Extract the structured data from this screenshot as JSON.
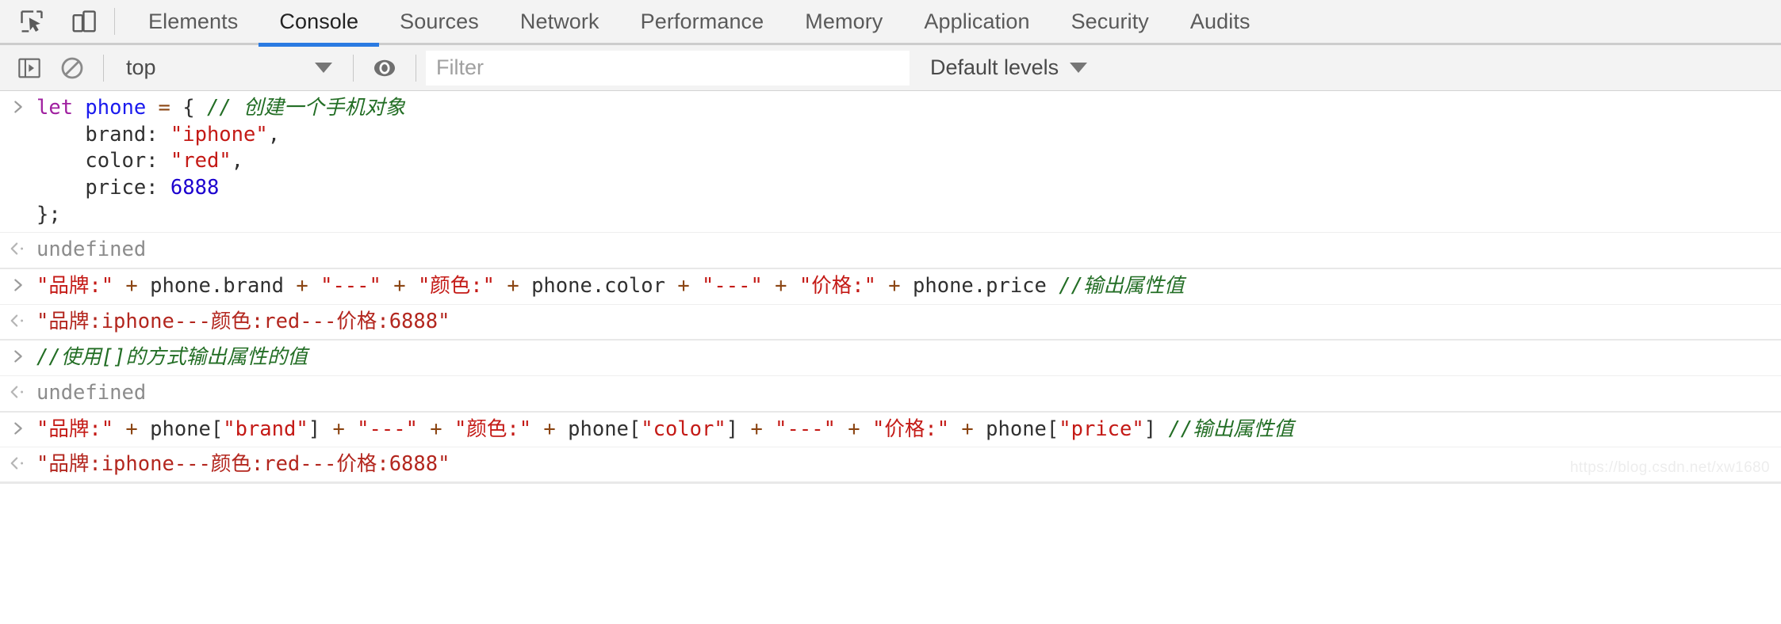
{
  "tabbar": {
    "icons": [
      {
        "name": "inspect-element-icon",
        "title": "Select an element in the page to inspect it"
      },
      {
        "name": "device-toolbar-icon",
        "title": "Toggle device toolbar"
      }
    ],
    "tabs": [
      {
        "label": "Elements",
        "active": false
      },
      {
        "label": "Console",
        "active": true
      },
      {
        "label": "Sources",
        "active": false
      },
      {
        "label": "Network",
        "active": false
      },
      {
        "label": "Performance",
        "active": false
      },
      {
        "label": "Memory",
        "active": false
      },
      {
        "label": "Application",
        "active": false
      },
      {
        "label": "Security",
        "active": false
      },
      {
        "label": "Audits",
        "active": false
      }
    ],
    "active_tab": "Console",
    "active_underline_color": "#2a7ae2"
  },
  "toolbar": {
    "sidebar_toggle": "console-sidebar-icon",
    "clear_console": "clear-console-icon",
    "context_selector": {
      "value": "top",
      "caret": "chevron-down-icon"
    },
    "eye_icon": "live-expression-eye-icon",
    "filter": {
      "value": "",
      "placeholder": "Filter"
    },
    "levels": {
      "label": "Default levels",
      "caret": "chevron-down-icon"
    }
  },
  "console": {
    "prompt_glyph": ">",
    "result_glyph": "<",
    "entries": [
      {
        "kind": "input",
        "id": "entry-1",
        "plain": "let phone = { // 创建一个手机对象\n    brand: \"iphone\",\n    color: \"red\",\n    price: 6888\n};",
        "lines": [
          {
            "tokens": [
              {
                "t": "let",
                "c": "kw"
              },
              {
                "t": " ",
                "c": "pun"
              },
              {
                "t": "phone",
                "c": "var"
              },
              {
                "t": " ",
                "c": "pun"
              },
              {
                "t": "=",
                "c": "op"
              },
              {
                "t": " { ",
                "c": "pun"
              },
              {
                "t": "// 创建一个手机对象",
                "c": "cmt"
              }
            ]
          },
          {
            "tokens": [
              {
                "t": "    brand: ",
                "c": "pun"
              },
              {
                "t": "\"iphone\"",
                "c": "str"
              },
              {
                "t": ",",
                "c": "pun"
              }
            ]
          },
          {
            "tokens": [
              {
                "t": "    color: ",
                "c": "pun"
              },
              {
                "t": "\"red\"",
                "c": "str"
              },
              {
                "t": ",",
                "c": "pun"
              }
            ]
          },
          {
            "tokens": [
              {
                "t": "    price: ",
                "c": "pun"
              },
              {
                "t": "6888",
                "c": "num"
              }
            ]
          },
          {
            "tokens": [
              {
                "t": "};",
                "c": "pun"
              }
            ]
          }
        ]
      },
      {
        "kind": "output",
        "id": "entry-1-result",
        "plain": "undefined",
        "lines": [
          {
            "tokens": [
              {
                "t": "undefined",
                "c": "undef"
              }
            ]
          }
        ]
      },
      {
        "kind": "input",
        "id": "entry-2",
        "plain": "\"品牌:\" + phone.brand + \"---\" + \"颜色:\" + phone.color + \"---\" + \"价格:\" + phone.price //输出属性值",
        "lines": [
          {
            "tokens": [
              {
                "t": "\"品牌:\"",
                "c": "str"
              },
              {
                "t": " ",
                "c": "pun"
              },
              {
                "t": "+",
                "c": "op"
              },
              {
                "t": " phone.brand ",
                "c": "pun"
              },
              {
                "t": "+",
                "c": "op"
              },
              {
                "t": " ",
                "c": "pun"
              },
              {
                "t": "\"---\"",
                "c": "str"
              },
              {
                "t": " ",
                "c": "pun"
              },
              {
                "t": "+",
                "c": "op"
              },
              {
                "t": " ",
                "c": "pun"
              },
              {
                "t": "\"颜色:\"",
                "c": "str"
              },
              {
                "t": " ",
                "c": "pun"
              },
              {
                "t": "+",
                "c": "op"
              },
              {
                "t": " phone.color ",
                "c": "pun"
              },
              {
                "t": "+",
                "c": "op"
              },
              {
                "t": " ",
                "c": "pun"
              },
              {
                "t": "\"---\"",
                "c": "str"
              },
              {
                "t": " ",
                "c": "pun"
              },
              {
                "t": "+",
                "c": "op"
              },
              {
                "t": " ",
                "c": "pun"
              },
              {
                "t": "\"价格:\"",
                "c": "str"
              },
              {
                "t": " ",
                "c": "pun"
              },
              {
                "t": "+",
                "c": "op"
              },
              {
                "t": " phone.price ",
                "c": "pun"
              },
              {
                "t": "//输出属性值",
                "c": "cmt"
              }
            ]
          }
        ]
      },
      {
        "kind": "output",
        "id": "entry-2-result",
        "plain": "\"品牌:iphone---颜色:red---价格:6888\"",
        "lines": [
          {
            "tokens": [
              {
                "t": "\"品牌:iphone---颜色:red---价格:6888\"",
                "c": "res-str"
              }
            ]
          }
        ]
      },
      {
        "kind": "input",
        "id": "entry-3",
        "plain": "//使用[]的方式输出属性的值",
        "lines": [
          {
            "tokens": [
              {
                "t": "//使用[]的方式输出属性的值",
                "c": "cmt"
              }
            ]
          }
        ]
      },
      {
        "kind": "output",
        "id": "entry-3-result",
        "plain": "undefined",
        "lines": [
          {
            "tokens": [
              {
                "t": "undefined",
                "c": "undef"
              }
            ]
          }
        ]
      },
      {
        "kind": "input",
        "id": "entry-4",
        "plain": "\"品牌:\" + phone[\"brand\"] + \"---\" + \"颜色:\" + phone[\"color\"] + \"---\" + \"价格:\" + phone[\"price\"] //输出属性值",
        "lines": [
          {
            "tokens": [
              {
                "t": "\"品牌:\"",
                "c": "str"
              },
              {
                "t": " ",
                "c": "pun"
              },
              {
                "t": "+",
                "c": "op"
              },
              {
                "t": " phone[",
                "c": "pun"
              },
              {
                "t": "\"brand\"",
                "c": "str"
              },
              {
                "t": "] ",
                "c": "pun"
              },
              {
                "t": "+",
                "c": "op"
              },
              {
                "t": " ",
                "c": "pun"
              },
              {
                "t": "\"---\"",
                "c": "str"
              },
              {
                "t": " ",
                "c": "pun"
              },
              {
                "t": "+",
                "c": "op"
              },
              {
                "t": " ",
                "c": "pun"
              },
              {
                "t": "\"颜色:\"",
                "c": "str"
              },
              {
                "t": " ",
                "c": "pun"
              },
              {
                "t": "+",
                "c": "op"
              },
              {
                "t": " phone[",
                "c": "pun"
              },
              {
                "t": "\"color\"",
                "c": "str"
              },
              {
                "t": "] ",
                "c": "pun"
              },
              {
                "t": "+",
                "c": "op"
              },
              {
                "t": " ",
                "c": "pun"
              },
              {
                "t": "\"---\"",
                "c": "str"
              },
              {
                "t": " ",
                "c": "pun"
              },
              {
                "t": "+",
                "c": "op"
              },
              {
                "t": " ",
                "c": "pun"
              },
              {
                "t": "\"价格:\"",
                "c": "str"
              },
              {
                "t": " ",
                "c": "pun"
              },
              {
                "t": "+",
                "c": "op"
              },
              {
                "t": " phone[",
                "c": "pun"
              },
              {
                "t": "\"price\"",
                "c": "str"
              },
              {
                "t": "] ",
                "c": "pun"
              },
              {
                "t": "//输出属性值",
                "c": "cmt"
              }
            ]
          }
        ]
      },
      {
        "kind": "output",
        "id": "entry-4-result",
        "plain": "\"品牌:iphone---颜色:red---价格:6888\"",
        "lines": [
          {
            "tokens": [
              {
                "t": "\"品牌:iphone---颜色:red---价格:6888\"",
                "c": "res-str"
              }
            ]
          }
        ]
      }
    ]
  },
  "watermark": {
    "text": "https://blog.csdn.net/xw1680"
  },
  "colors": {
    "accent": "#2a7ae2",
    "toolbar_bg": "#f3f3f3",
    "console_bg": "#ffffff",
    "keyword": "#a020a0",
    "variable": "#1a1aee",
    "operator": "#8b4513",
    "string": "#c41a16",
    "number": "#1c00cf",
    "comment": "#236e25",
    "undefined": "#8c8c8c"
  }
}
